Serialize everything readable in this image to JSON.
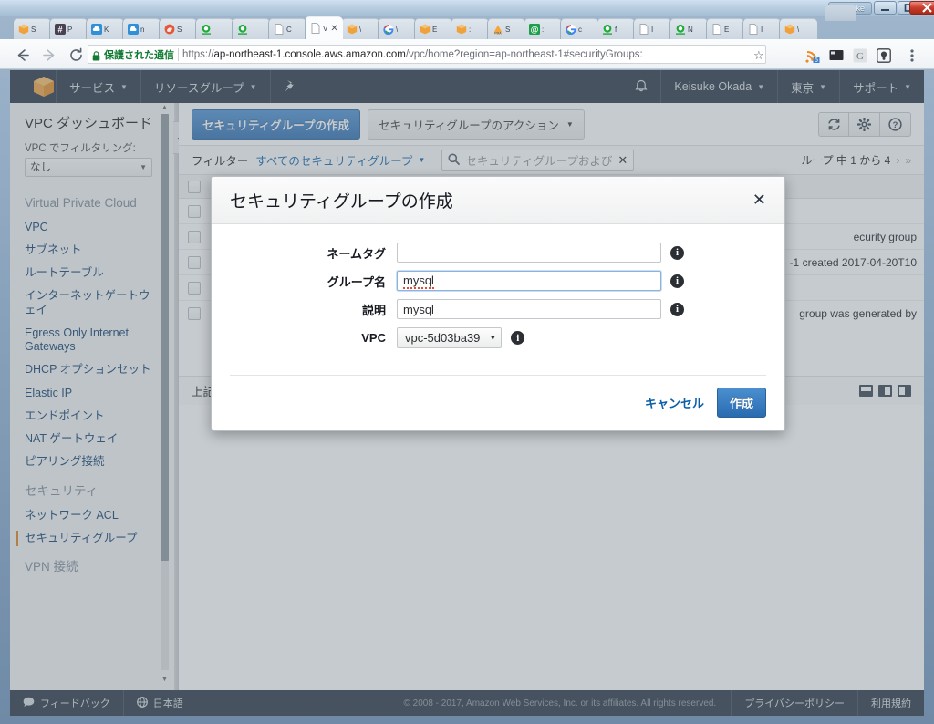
{
  "window": {
    "user_chip": "Keisuke",
    "minimize_icon": "minimize-icon",
    "maximize_icon": "maximize-icon",
    "close_icon": "close-icon"
  },
  "browser": {
    "back_icon": "back-arrow-icon",
    "forward_icon": "forward-arrow-icon",
    "reload_icon": "reload-icon",
    "secure_label": "保護された通信",
    "lock_icon": "lock-icon",
    "url_prefix": "https://",
    "url_domain": "ap-northeast-1.console.aws.amazon.com",
    "url_path": "/vpc/home?region=ap-northeast-1#securityGroups:",
    "star_icon": "bookmark-star-icon",
    "extensions": [
      "rss-feed-icon",
      "screen-icon",
      "google-g-icon",
      "lightbulb-icon"
    ],
    "menu_icon": "kebab-menu-icon",
    "new_tab_icon": "new-tab-icon",
    "tabs": [
      {
        "label": "S",
        "favicon": "aws-box-icon",
        "color": "#e8a33d",
        "active": false
      },
      {
        "label": "P",
        "favicon": "hash-icon",
        "color": "#4a4150",
        "active": false
      },
      {
        "label": "K",
        "favicon": "cloud-icon",
        "color": "#2f8fd8",
        "active": false
      },
      {
        "label": "n",
        "favicon": "cloud-icon",
        "color": "#2f8fd8",
        "active": false
      },
      {
        "label": "S",
        "favicon": "firefox-icon",
        "color": "#e3583a",
        "active": false
      },
      {
        "label": "",
        "favicon": "search-green-icon",
        "color": "#1faa39",
        "active": false
      },
      {
        "label": "",
        "favicon": "search-green-icon",
        "color": "#1faa39",
        "active": false
      },
      {
        "label": "C",
        "favicon": "document-icon",
        "color": "#ffffff",
        "active": false
      },
      {
        "label": "V",
        "favicon": "page-icon",
        "color": "#ffffff",
        "active": true
      },
      {
        "label": "\\",
        "favicon": "aws-box-icon",
        "color": "#e8a33d",
        "active": false
      },
      {
        "label": "\\",
        "favicon": "google-g-icon",
        "color": "#ffffff",
        "active": false
      },
      {
        "label": "E",
        "favicon": "aws-box-icon",
        "color": "#e8a33d",
        "active": false
      },
      {
        "label": ":",
        "favicon": "aws-box-icon",
        "color": "#e8a33d",
        "active": false
      },
      {
        "label": "S",
        "favicon": "pma-icon",
        "color": "#f5a53c",
        "active": false
      },
      {
        "label": ":",
        "favicon": "at-sign-icon",
        "color": "#1f9e4a",
        "active": false
      },
      {
        "label": "c",
        "favicon": "google-g-icon",
        "color": "#ffffff",
        "active": false
      },
      {
        "label": "f",
        "favicon": "search-green-icon",
        "color": "#1faa39",
        "active": false
      },
      {
        "label": "I",
        "favicon": "document-icon",
        "color": "#ffffff",
        "active": false
      },
      {
        "label": "N",
        "favicon": "search-green-icon",
        "color": "#1faa39",
        "active": false
      },
      {
        "label": "E",
        "favicon": "document-icon",
        "color": "#ffffff",
        "active": false
      },
      {
        "label": "I",
        "favicon": "document-icon",
        "color": "#ffffff",
        "active": false
      },
      {
        "label": "\\",
        "favicon": "aws-box-icon",
        "color": "#e8a33d",
        "active": false
      }
    ]
  },
  "aws_nav": {
    "logo_icon": "aws-cube-logo-icon",
    "services": "サービス",
    "resource_groups": "リソースグループ",
    "pin_icon": "pin-icon",
    "bell_icon": "notifications-bell-icon",
    "account": "Keisuke Okada",
    "region": "東京",
    "support": "サポート"
  },
  "sidebar": {
    "title": "VPC ダッシュボード",
    "filter_label": "VPC でフィルタリング:",
    "filter_value": "なし",
    "scroll_up_icon": "scroll-up-arrow-icon",
    "scroll_down_icon": "scroll-down-arrow-icon",
    "collapse_icon": "collapse-left-icon",
    "groups": [
      {
        "label": "Virtual Private Cloud",
        "items": [
          {
            "label": "VPC",
            "active": false
          },
          {
            "label": "サブネット",
            "active": false
          },
          {
            "label": "ルートテーブル",
            "active": false
          },
          {
            "label": "インターネットゲートウェイ",
            "active": false
          },
          {
            "label": "Egress Only Internet Gateways",
            "active": false
          },
          {
            "label": "DHCP オプションセット",
            "active": false
          },
          {
            "label": "Elastic IP",
            "active": false
          },
          {
            "label": "エンドポイント",
            "active": false
          },
          {
            "label": "NAT ゲートウェイ",
            "active": false
          },
          {
            "label": "ピアリング接続",
            "active": false
          }
        ]
      },
      {
        "label": "セキュリティ",
        "items": [
          {
            "label": "ネットワーク ACL",
            "active": false
          },
          {
            "label": "セキュリティグループ",
            "active": true
          }
        ]
      },
      {
        "label": "VPN 接続",
        "items": []
      }
    ]
  },
  "toolbar": {
    "create_sg": "セキュリティグループの作成",
    "sg_actions": "セキュリティグループのアクション",
    "refresh_icon": "refresh-icon",
    "settings_icon": "gear-icon",
    "help_icon": "help-question-icon"
  },
  "filterbar": {
    "label": "フィルター",
    "select_value": "すべてのセキュリティグループ",
    "search_icon": "search-icon",
    "search_placeholder": "セキュリティグループおよび",
    "search_clear_icon": "clear-x-icon",
    "pagination": "ループ 中 1 から 4",
    "page_prev_icon": "page-prev-icon",
    "page_next_icon": "page-next-icon"
  },
  "table": {
    "rows": [
      {
        "text": ""
      },
      {
        "text": "ecurity group"
      },
      {
        "text": "-1 created 2017-04-20T10"
      },
      {
        "text": ""
      },
      {
        "text": "group was generated by "
      }
    ]
  },
  "detailbar": {
    "message": "上記からセキュリティグループを選択",
    "layout_icons": [
      "layout-bottom-icon",
      "layout-left-icon",
      "layout-right-icon"
    ]
  },
  "modal": {
    "title": "セキュリティグループの作成",
    "close_icon": "close-x-icon",
    "info_icon": "info-icon",
    "fields": [
      {
        "label": "ネームタグ",
        "value": "",
        "type": "text",
        "focused": false,
        "misspelled": false
      },
      {
        "label": "グループ名",
        "value": "mysql",
        "type": "text",
        "focused": true,
        "misspelled": true
      },
      {
        "label": "説明",
        "value": "mysql",
        "type": "text",
        "focused": false,
        "misspelled": false
      },
      {
        "label": "VPC",
        "value": "vpc-5d03ba39",
        "type": "select",
        "focused": false,
        "misspelled": false
      }
    ],
    "cancel_label": "キャンセル",
    "create_label": "作成"
  },
  "page_footer": {
    "feedback": "フィードバック",
    "feedback_icon": "speech-bubble-icon",
    "language": "日本語",
    "language_icon": "globe-icon",
    "copyright": "© 2008 - 2017, Amazon Web Services, Inc. or its affiliates. All rights reserved.",
    "privacy": "プライバシーポリシー",
    "terms": "利用規約"
  },
  "colors": {
    "aws_navy": "#232f3e",
    "aws_blue_button": "#2a6bb0",
    "link_blue": "#0a5fa8",
    "active_orange": "#e07b1a"
  }
}
